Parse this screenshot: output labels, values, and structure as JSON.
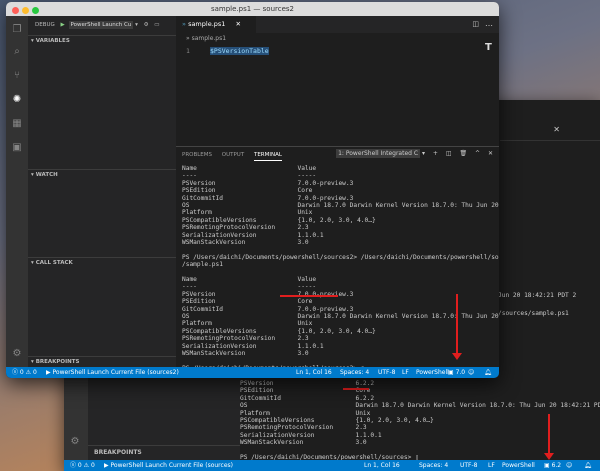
{
  "window": {
    "title": "sample.ps1 — sources2"
  },
  "sidebar": {
    "debug_label": "DEBUG",
    "launch_config": "PowerShell Launch Cu",
    "sections": {
      "variables": "VARIABLES",
      "watch": "WATCH",
      "call_stack": "CALL STACK",
      "breakpoints": "BREAKPOINTS"
    }
  },
  "editor": {
    "tab": "sample.ps1",
    "breadcrumb": "sample.ps1",
    "line_number": "1",
    "code": "$PSVersionTable"
  },
  "panel": {
    "tabs": [
      "PROBLEMS",
      "OUTPUT",
      "TERMINAL"
    ],
    "terminal_select": "1: PowerShell Integrated C",
    "lines1": [
      "Name                           Value",
      "----                           -----",
      "PSVersion                      7.0.0-preview.3",
      "PSEdition                      Core",
      "GitCommitId                    7.0.0-preview.3",
      "OS                             Darwin 18.7.0 Darwin Kernel Version 18.7.0: Thu Jun 20 18:42:21 PDT 2",
      "Platform                       Unix",
      "PSCompatibleVersions           {1.0, 2.0, 3.0, 4.0…}",
      "PSRemotingProtocolVersion      2.3",
      "SerializationVersion           1.1.0.1",
      "WSManStackVersion              3.0",
      "",
      "PS /Users/daichi/Documents/powershell/sources2> /Users/daichi/Documents/powershell/sources2",
      "/sample.ps1",
      "",
      "Name                           Value",
      "----                           -----",
      "PSVersion                      7.0.0-preview.3",
      "PSEdition                      Core",
      "GitCommitId                    7.0.0-preview.3",
      "OS                             Darwin 18.7.0 Darwin Kernel Version 18.7.0: Thu Jun 20 18:42:21 PDT 2",
      "Platform                       Unix",
      "PSCompatibleVersions           {1.0, 2.0, 3.0, 4.0…}",
      "PSRemotingProtocolVersion      2.3",
      "SerializationVersion           1.1.0.1",
      "WSManStackVersion              3.0",
      "",
      "PS /Users/daichi/Documents/powershell/sources2> ▯"
    ]
  },
  "status1": {
    "errors": "0",
    "warnings": "0",
    "launch": "PowerShell Launch Current File (sources2)",
    "position": "Ln 1, Col 16",
    "spaces": "Spaces: 4",
    "encoding": "UTF-8",
    "eol": "LF",
    "language": "PowerShell",
    "ps_version": "7.0"
  },
  "win2": {
    "breakpoints": "BREAKPOINTS",
    "lines_right": [
      "Jun 20 18:42:21 PDT 2",
      "/sources/sample.ps1"
    ],
    "lines": [
      "PSVersion                      6.2.2",
      "PSEdition                      Core",
      "GitCommitId                    6.2.2",
      "OS                             Darwin 18.7.0 Darwin Kernel Version 18.7.0: Thu Jun 20 18:42:21 PDT 2",
      "Platform                       Unix",
      "PSCompatibleVersions           {1.0, 2.0, 3.0, 4.0…}",
      "PSRemotingProtocolVersion      2.3",
      "SerializationVersion           1.1.0.1",
      "WSManStackVersion              3.0",
      "",
      "PS /Users/daichi/Documents/powershell/sources> ▯"
    ],
    "status": {
      "errors": "0",
      "warnings": "0",
      "launch": "PowerShell Launch Current File (sources)",
      "position": "Ln 1, Col 16",
      "spaces": "Spaces: 4",
      "encoding": "UTF-8",
      "eol": "LF",
      "language": "PowerShell",
      "ps_version": "6.2"
    }
  },
  "colors": {
    "accent": "#007acc",
    "annotation": "#e01e1e",
    "var": "#9cdcfe",
    "highlight": "#ce9178"
  }
}
